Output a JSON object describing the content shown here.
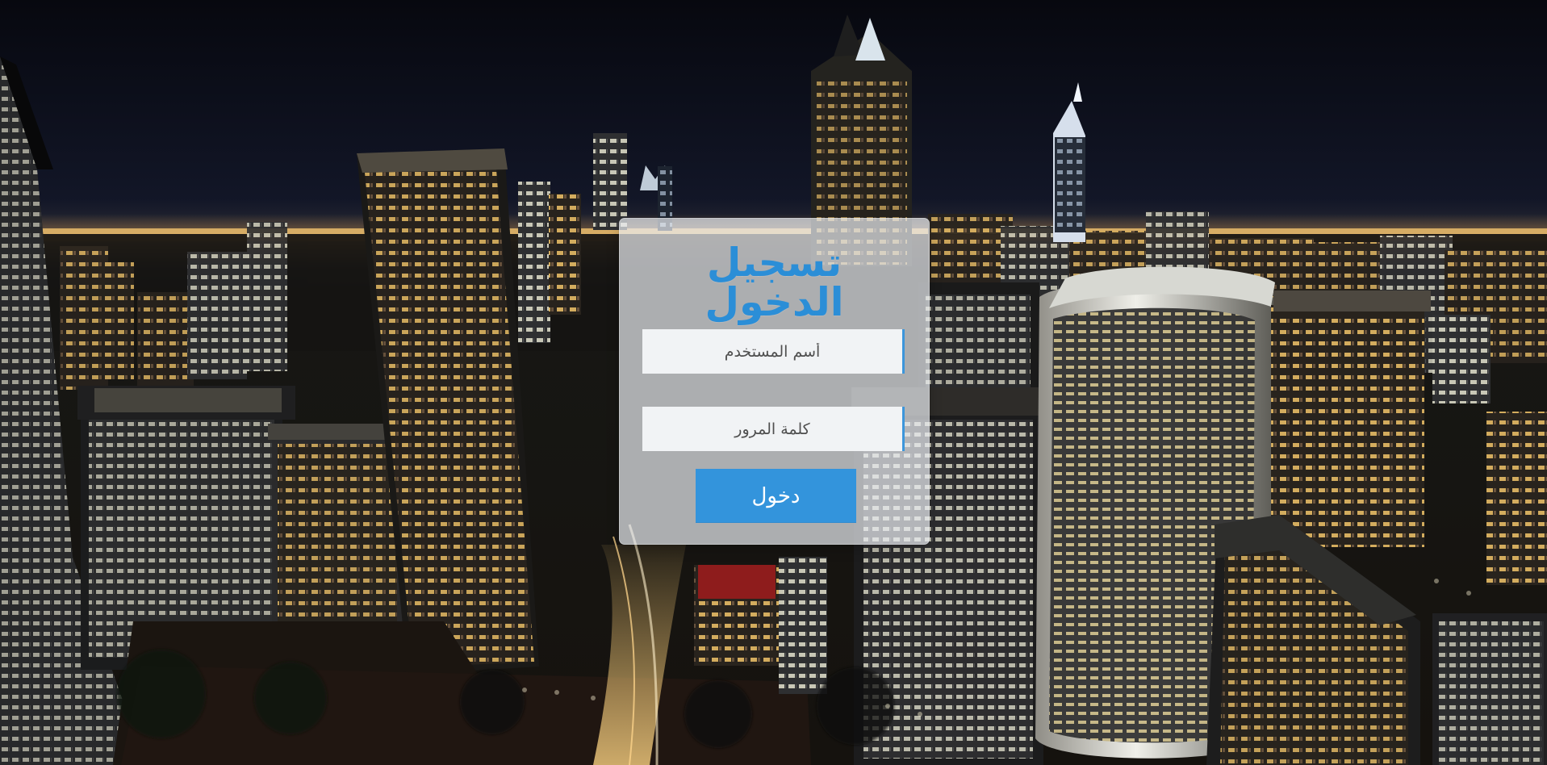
{
  "login": {
    "title": "تسجيل الدخول",
    "username_placeholder": "أسم المستخدم",
    "password_placeholder": "كلمة المرور",
    "submit_label": "دخول"
  },
  "colors": {
    "accent": "#2b8ed7",
    "button": "#3394dc",
    "field": "#f1f3f5",
    "card": "rgba(236, 239, 243, 0.70)"
  }
}
